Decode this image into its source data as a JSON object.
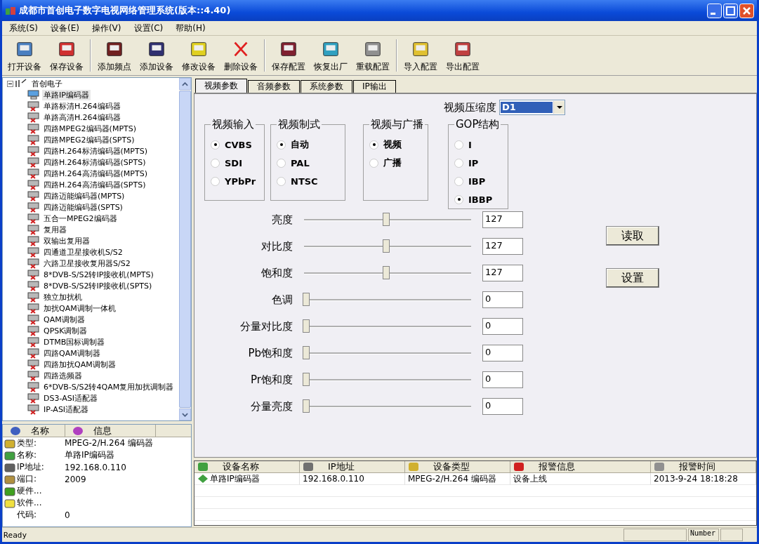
{
  "window": {
    "title": "成都市首创电子数字电视网络管理系统(版本::4.40)"
  },
  "menu": [
    "系统(S)",
    "设备(E)",
    "操作(V)",
    "设置(C)",
    "帮助(H)"
  ],
  "toolbar": [
    [
      {
        "label": "打开设备",
        "kind": "open"
      },
      {
        "label": "保存设备",
        "kind": "save"
      }
    ],
    [
      {
        "label": "添加频点",
        "kind": "film"
      },
      {
        "label": "添加设备",
        "kind": "screen"
      },
      {
        "label": "修改设备",
        "kind": "pen"
      },
      {
        "label": "删除设备",
        "kind": "delete"
      }
    ],
    [
      {
        "label": "保存配置",
        "kind": "disk"
      },
      {
        "label": "恢复出厂",
        "kind": "box"
      },
      {
        "label": "重载配置",
        "kind": "doc"
      }
    ],
    [
      {
        "label": "导入配置",
        "kind": "folder"
      },
      {
        "label": "导出配置",
        "kind": "export"
      }
    ]
  ],
  "tree": {
    "label": "首创电子",
    "expanded": true,
    "children": [
      {
        "label": "单路IP编码器",
        "selected": true,
        "online": true
      },
      {
        "label": "单路标清H.264编码器",
        "selected": false,
        "online": false
      },
      {
        "label": "单路高清H.264编码器",
        "selected": false,
        "online": false
      },
      {
        "label": "四路MPEG2编码器(MPTS)",
        "selected": false,
        "online": false
      },
      {
        "label": "四路MPEG2编码器(SPTS)",
        "selected": false,
        "online": false
      },
      {
        "label": "四路H.264标清编码器(MPTS)",
        "selected": false,
        "online": false
      },
      {
        "label": "四路H.264标清编码器(SPTS)",
        "selected": false,
        "online": false
      },
      {
        "label": "四路H.264高清编码器(MPTS)",
        "selected": false,
        "online": false
      },
      {
        "label": "四路H.264高清编码器(SPTS)",
        "selected": false,
        "online": false
      },
      {
        "label": "四路迈能编码器(MPTS)",
        "selected": false,
        "online": false
      },
      {
        "label": "四路迈能编码器(SPTS)",
        "selected": false,
        "online": false
      },
      {
        "label": "五合一MPEG2编码器",
        "selected": false,
        "online": false
      },
      {
        "label": "复用器",
        "selected": false,
        "online": false
      },
      {
        "label": "双输出复用器",
        "selected": false,
        "online": false
      },
      {
        "label": "四通道卫星接收机S/S2",
        "selected": false,
        "online": false
      },
      {
        "label": "六路卫星接收复用器S/S2",
        "selected": false,
        "online": false
      },
      {
        "label": "8*DVB-S/S2转IP接收机(MPTS)",
        "selected": false,
        "online": false
      },
      {
        "label": "8*DVB-S/S2转IP接收机(SPTS)",
        "selected": false,
        "online": false
      },
      {
        "label": "独立加扰机",
        "selected": false,
        "online": false
      },
      {
        "label": "加扰QAM调制一体机",
        "selected": false,
        "online": false
      },
      {
        "label": "QAM调制器",
        "selected": false,
        "online": false
      },
      {
        "label": "QPSK调制器",
        "selected": false,
        "online": false
      },
      {
        "label": "DTMB国标调制器",
        "selected": false,
        "online": false
      },
      {
        "label": "四路QAM调制器",
        "selected": false,
        "online": false
      },
      {
        "label": "四路加扰QAM调制器",
        "selected": false,
        "online": false
      },
      {
        "label": "四路选频器",
        "selected": false,
        "online": false
      },
      {
        "label": "6*DVB-S/S2转4QAM复用加扰调制器",
        "selected": false,
        "online": false
      },
      {
        "label": "DS3-ASI适配器",
        "selected": false,
        "online": false
      },
      {
        "label": "IP-ASI适配器",
        "selected": false,
        "online": false
      }
    ]
  },
  "info": {
    "columns": [
      "名称",
      "信息"
    ],
    "rows": [
      {
        "label": "类型:",
        "value": "MPEG-2/H.264 编码器",
        "kind": "type"
      },
      {
        "label": "名称:",
        "value": "单路IP编码器",
        "kind": "name"
      },
      {
        "label": "IP地址:",
        "value": "192.168.0.110",
        "kind": "ip"
      },
      {
        "label": "端口:",
        "value": "2009",
        "kind": "port"
      },
      {
        "label": "硬件...",
        "kind": "hardware"
      },
      {
        "label": "软件...",
        "kind": "software"
      },
      {
        "label": "代码:",
        "value": "0",
        "kind": "none"
      }
    ]
  },
  "tabs": [
    {
      "label": "视频参数",
      "selected": true
    },
    {
      "label": "音频参数",
      "selected": false
    },
    {
      "label": "系统参数",
      "selected": false
    },
    {
      "label": "IP输出",
      "selected": false
    }
  ],
  "compression": {
    "label": "视频压缩度",
    "value": "D1"
  },
  "groups": [
    {
      "title": "视频输入",
      "options": [
        {
          "label": "CVBS",
          "selected": true
        },
        {
          "label": "SDI",
          "selected": false
        },
        {
          "label": "YPbPr",
          "selected": false
        }
      ]
    },
    {
      "title": "视频制式",
      "options": [
        {
          "label": "自动",
          "selected": true
        },
        {
          "label": "PAL",
          "selected": false
        },
        {
          "label": "NTSC",
          "selected": false
        }
      ]
    },
    {
      "title": "视频与广播",
      "options": [
        {
          "label": "视频",
          "selected": true
        },
        {
          "label": "广播",
          "selected": false
        }
      ]
    },
    {
      "title": "GOP结构",
      "options": [
        {
          "label": "I",
          "selected": false
        },
        {
          "label": "IP",
          "selected": false
        },
        {
          "label": "IBP",
          "selected": false
        },
        {
          "label": "IBBP",
          "selected": true
        }
      ]
    }
  ],
  "sliders": [
    {
      "label": "亮度",
      "level": 0.5,
      "value": "127"
    },
    {
      "label": "对比度",
      "level": 0.5,
      "value": "127"
    },
    {
      "label": "饱和度",
      "level": 0.5,
      "value": "127"
    },
    {
      "label": "色调",
      "level": 0,
      "value": "0"
    },
    {
      "label": "分量对比度",
      "level": 0,
      "value": "0"
    },
    {
      "label": "Pb饱和度",
      "level": 0,
      "value": "0"
    },
    {
      "label": "Pr饱和度",
      "level": 0,
      "value": "0"
    },
    {
      "label": "分量亮度",
      "level": 0,
      "value": "0"
    }
  ],
  "buttons": [
    "读取",
    "设置"
  ],
  "alarms": {
    "columns": [
      {
        "label": "设备名称",
        "kind": "name"
      },
      {
        "label": "IP地址",
        "kind": "ip"
      },
      {
        "label": "设备类型",
        "kind": "type"
      },
      {
        "label": "报警信息",
        "kind": "alarm"
      },
      {
        "label": "报警时间",
        "kind": "time"
      }
    ],
    "rows": [
      {
        "cells": [
          "单路IP编码器",
          "192.168.0.110",
          "MPEG-2/H.264 编码器",
          "设备上线",
          "2013-9-24 18:18:28"
        ]
      }
    ]
  },
  "status_bar": {
    "message": "Ready",
    "indicator": "Number"
  }
}
